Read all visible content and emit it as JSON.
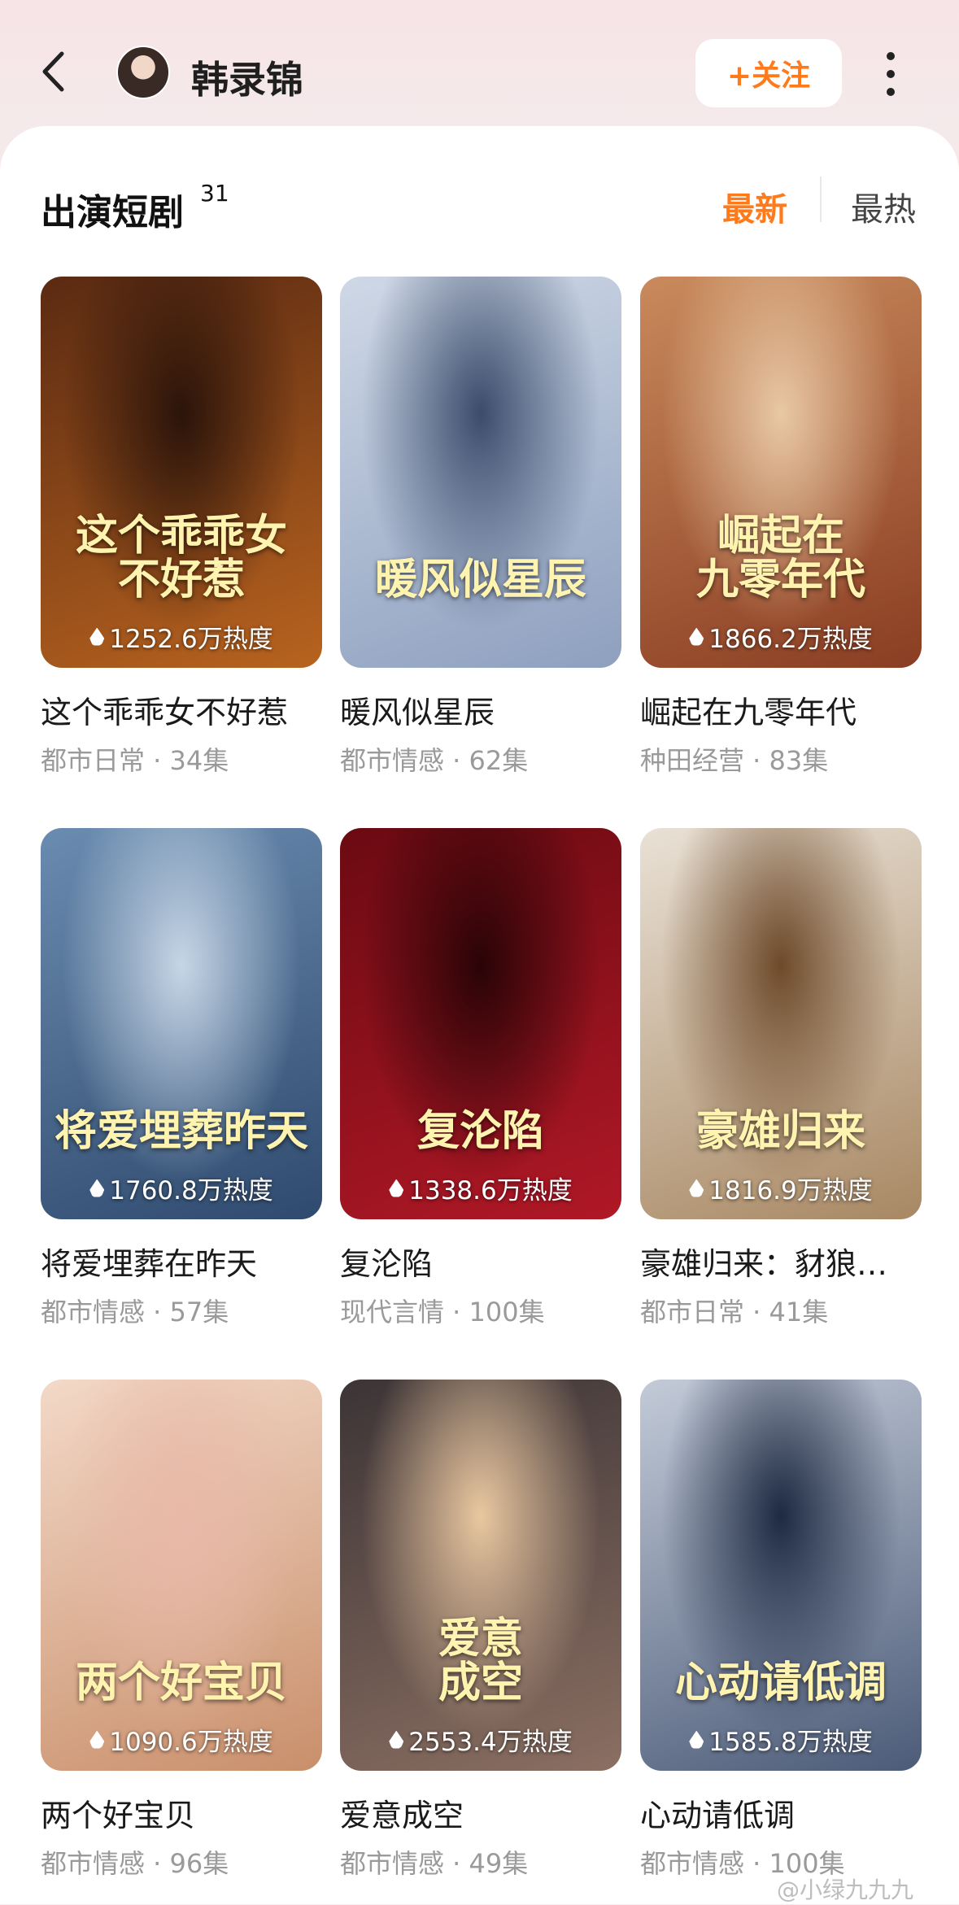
{
  "header": {
    "username": "韩录锦",
    "follow_label": "+关注"
  },
  "section": {
    "title": "出演短剧",
    "count": "31",
    "sort_new": "最新",
    "sort_hot": "最热"
  },
  "dramas": [
    {
      "title": "这个乖乖女不好惹",
      "meta": "都市日常 · 34集",
      "heat": "1252.6万热度",
      "poster_text": "这个乖乖女\n不好惹",
      "colors": [
        "#5a2a12",
        "#b8631f",
        "#2b140a"
      ]
    },
    {
      "title": "暖风似星辰",
      "meta": "都市情感 · 62集",
      "heat": "",
      "poster_text": "暖风似星辰",
      "colors": [
        "#cfd8e6",
        "#8ea0bf",
        "#3b4c6b"
      ]
    },
    {
      "title": "崛起在九零年代",
      "meta": "种田经营 · 83集",
      "heat": "1866.2万热度",
      "poster_text": "崛起在\n九零年代",
      "colors": [
        "#c98a5c",
        "#8a3d22",
        "#e8c8a4"
      ]
    },
    {
      "title": "将爱埋葬在昨天",
      "meta": "都市情感 · 57集",
      "heat": "1760.8万热度",
      "poster_text": "将爱埋葬昨天",
      "colors": [
        "#6a8cb0",
        "#2f4a6e",
        "#c7d6e6"
      ]
    },
    {
      "title": "复沦陷",
      "meta": "现代言情 · 100集",
      "heat": "1338.6万热度",
      "poster_text": "复沦陷",
      "colors": [
        "#6b0a12",
        "#b01826",
        "#2a0407"
      ]
    },
    {
      "title": "豪雄归来：豺狼…",
      "meta": "都市日常 · 41集",
      "heat": "1816.9万热度",
      "poster_text": "豪雄归来",
      "colors": [
        "#e9e1d6",
        "#a88863",
        "#6e4a2a"
      ]
    },
    {
      "title": "两个好宝贝",
      "meta": "都市情感 · 96集",
      "heat": "1090.6万热度",
      "poster_text": "两个好宝贝",
      "colors": [
        "#f3d9c8",
        "#c98f6b",
        "#e8b9a8"
      ]
    },
    {
      "title": "爱意成空",
      "meta": "都市情感 · 49集",
      "heat": "2553.4万热度",
      "poster_text": "爱意\n成空",
      "colors": [
        "#3c3436",
        "#8b6f62",
        "#e9c7a0"
      ]
    },
    {
      "title": "心动请低调",
      "meta": "都市情感 · 100集",
      "heat": "1585.8万热度",
      "poster_text": "心动请低调",
      "colors": [
        "#c3cbd8",
        "#4c5b78",
        "#1e2a42"
      ]
    }
  ],
  "watermark": "@小绿九九九",
  "colors": {
    "accent": "#ff7a1a"
  }
}
